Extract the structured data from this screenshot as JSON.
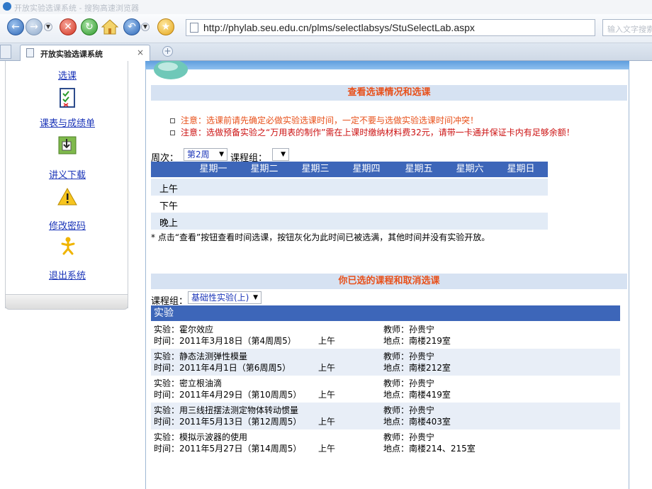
{
  "window": {
    "title": "开放实验选课系统 - 搜狗高速浏览器"
  },
  "toolbar": {
    "url": "http://phylab.seu.edu.cn/plms/selectlabsys/StuSelectLab.aspx",
    "search_placeholder": "输入文字搜索"
  },
  "tabs": {
    "active_label": "开放实验选课系统",
    "close_glyph": "×",
    "new_glyph": "+"
  },
  "sidebar": {
    "items": [
      {
        "label": "选课",
        "icon": "checklist-icon"
      },
      {
        "label": "课表与成绩单",
        "icon": "download-icon"
      },
      {
        "label": "讲义下载",
        "icon": "warning-icon"
      },
      {
        "label": "修改密码",
        "icon": "person-icon"
      },
      {
        "label": "退出系统"
      }
    ]
  },
  "section1": {
    "title": "查看选课情况和选课",
    "notice1": "注意：选课前请先确定必做实验选课时间，一定不要与选做实验选课时间冲突！",
    "notice2": "注意：选做预备实验之“万用表的制作”需在上课时缴纳材料费32元，请带一卡通并保证卡内有足够余额！"
  },
  "filters": {
    "week_label": "周次：",
    "week_value": "第2周",
    "group_label": "课程组：",
    "group_value": ""
  },
  "week_table": {
    "days": [
      "星期一",
      "星期二",
      "星期三",
      "星期四",
      "星期五",
      "星期六",
      "星期日"
    ],
    "periods": [
      "上午",
      "下午",
      "晚上"
    ],
    "note": "* 点击“查看”按钮查看时间选课，按钮灰化为此时间已被选满，其他时间并没有实验开放。"
  },
  "section2": {
    "title": "你已选的课程和取消选课",
    "group_label": "课程组：",
    "group_value": "基础性实验(上)"
  },
  "courses": {
    "header": "实验",
    "rows": [
      {
        "name": "实验：霍尔效应",
        "time": "时间：2011年3月18日（第4周周5）",
        "slot": "上午",
        "teacher": "教师：孙贵宁",
        "place": "地点：南楼219室"
      },
      {
        "name": "实验：静态法测弹性模量",
        "time": "时间：2011年4月1日（第6周周5）",
        "slot": "上午",
        "teacher": "教师：孙贵宁",
        "place": "地点：南楼212室"
      },
      {
        "name": "实验：密立根油滴",
        "time": "时间：2011年4月29日（第10周周5）",
        "slot": "上午",
        "teacher": "教师：孙贵宁",
        "place": "地点：南楼419室"
      },
      {
        "name": "实验：用三线扭摆法测定物体转动惯量",
        "time": "时间：2011年5月13日（第12周周5）",
        "slot": "上午",
        "teacher": "教师：孙贵宁",
        "place": "地点：南楼403室"
      },
      {
        "name": "实验：模拟示波器的使用",
        "time": "时间：2011年5月27日（第14周周5）",
        "slot": "上午",
        "teacher": "教师：孙贵宁",
        "place": "地点：南楼214、215室"
      }
    ]
  },
  "colors": {
    "accent": "#3d66b9",
    "notice": "#e8501a",
    "link": "#1a34b8",
    "section_bg": "#d6e2f2"
  }
}
